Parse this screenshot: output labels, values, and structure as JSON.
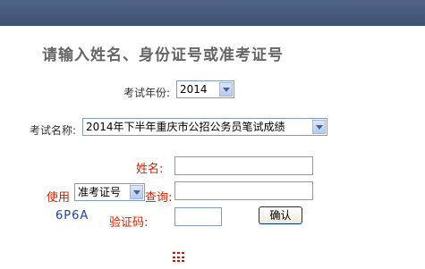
{
  "header": {
    "title": "请输入姓名、身份证号或准考证号"
  },
  "form": {
    "year_label": "考试年份:",
    "year_value": "2014",
    "exam_label": "考试名称:",
    "exam_value": "2014年下半年重庆市公招公务员笔试成绩",
    "name_label": "姓名:",
    "use_label": "使用",
    "query_type_value": "准考证号",
    "query_label": "查询:",
    "captcha_code": "6P6A",
    "captcha_label": "验证码:",
    "submit_label": "确认"
  },
  "colors": {
    "top_bar": "#4e6486",
    "red_label": "#cc2200",
    "captcha_text": "#1a3fa8"
  },
  "icons": {
    "bottom_icon": "grid-icon"
  }
}
